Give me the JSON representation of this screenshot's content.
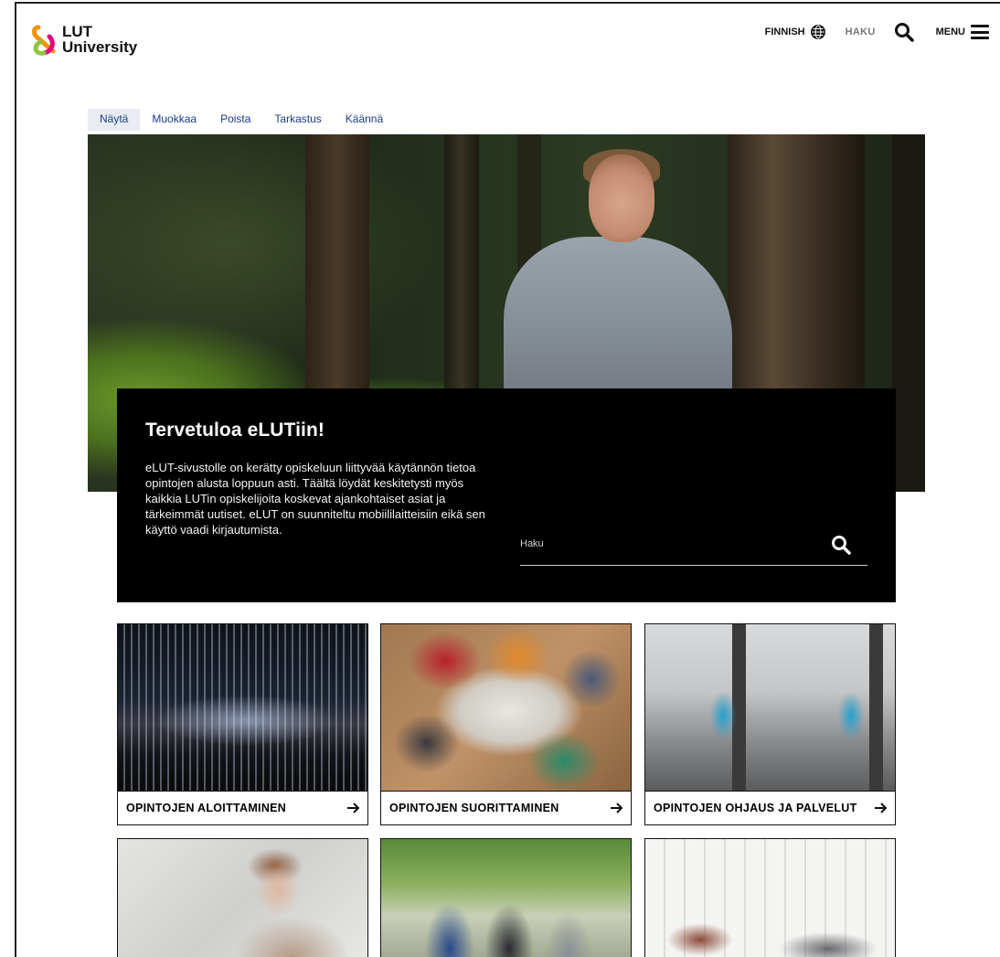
{
  "header": {
    "logo": {
      "line1": "LUT",
      "line2": "University"
    },
    "language_label": "FINNISH",
    "search_label": "HAKU",
    "menu_label": "MENU"
  },
  "admin_tabs": [
    {
      "label": "Näytä",
      "active": true
    },
    {
      "label": "Muokkaa",
      "active": false
    },
    {
      "label": "Poista",
      "active": false
    },
    {
      "label": "Tarkastus",
      "active": false
    },
    {
      "label": "Käännä",
      "active": false
    }
  ],
  "welcome": {
    "title": "Tervetuloa eLUTiin!",
    "body": "eLUT-sivustolle on kerätty opiskeluun liittyvää käytännön tietoa opintojen alusta loppuun asti. Täältä löydät keskitetysti myös kaikkia LUTin opiskelijoita koskevat ajankohtaiset asiat ja tärkeimmät uutiset. eLUT on suunniteltu mobiililaitteisiin eikä sen käyttö vaadi kirjautumista.",
    "search_placeholder": "Haku"
  },
  "cards": [
    {
      "label": "OPINTOJEN ALOITTAMINEN",
      "image": "auditorium-photo"
    },
    {
      "label": "OPINTOJEN SUORITTAMINEN",
      "image": "students-at-table-photo"
    },
    {
      "label": "OPINTOJEN OHJAUS JA PALVELUT",
      "image": "gym-photo"
    },
    {
      "label": "",
      "image": "student-with-laptop-photo"
    },
    {
      "label": "",
      "image": "students-walking-photo"
    },
    {
      "label": "",
      "image": "study-lounge-photo"
    }
  ],
  "colors": {
    "tab_text": "#1a3a8f",
    "tab_active_bg": "#e9ecf2",
    "logo_orange": "#f39200",
    "logo_pink": "#e5007d",
    "logo_green": "#8dc63f"
  }
}
